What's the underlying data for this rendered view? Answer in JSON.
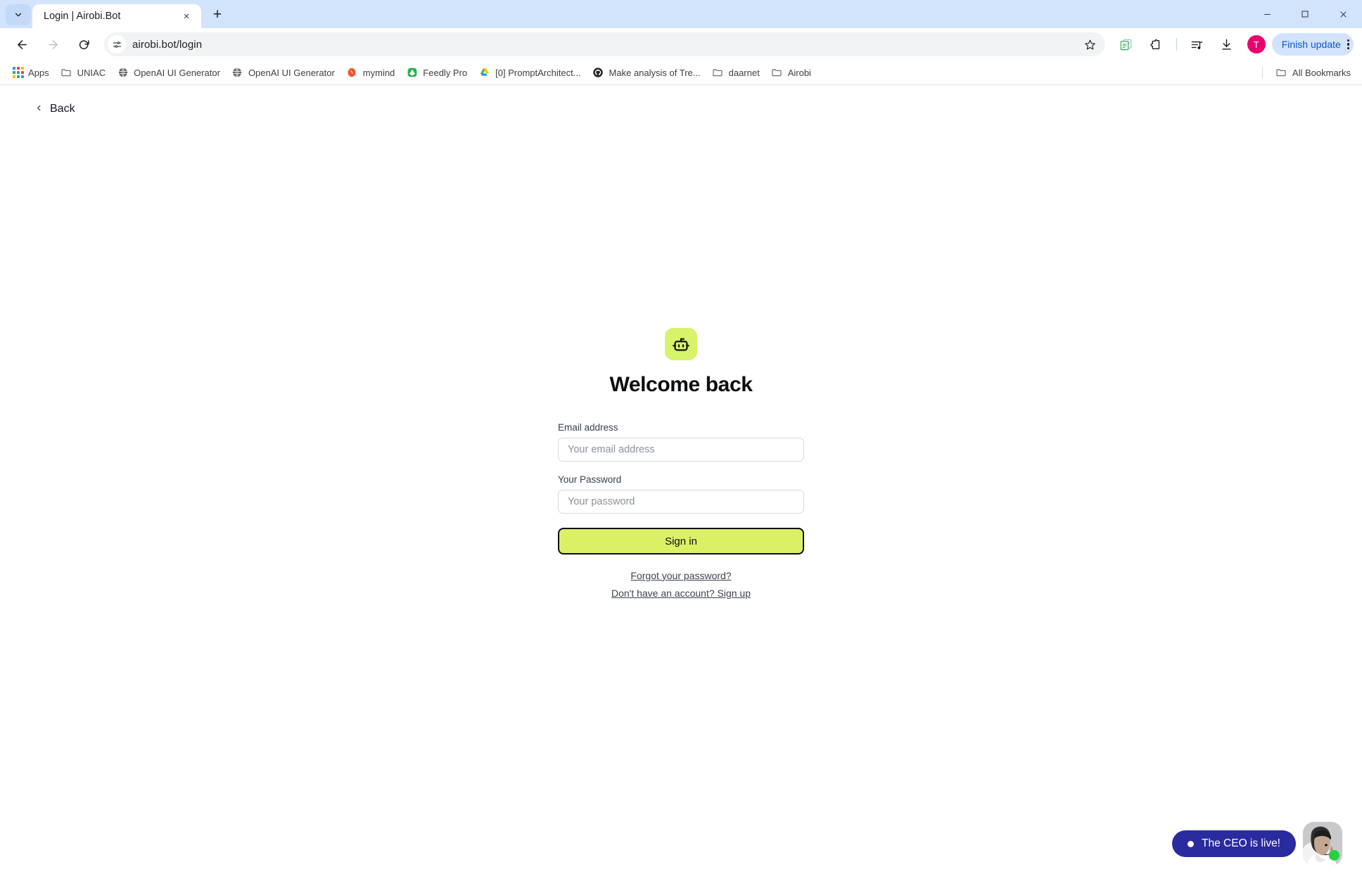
{
  "browser": {
    "tab": {
      "title": "Login | Airobi.Bot",
      "close_label": "×"
    },
    "new_tab_label": "+",
    "tab_search_icon": "chevron-down-icon",
    "window_controls": {
      "minimize": "—",
      "maximize": "□",
      "close": "✕"
    },
    "omnibox": {
      "url": "airobi.bot/login",
      "site_settings_icon": "tune-icon",
      "bookmark_icon": "star-icon"
    },
    "toolbar_icons": [
      "reading-list-icon",
      "extensions-icon",
      "media-controls-icon",
      "downloads-icon"
    ],
    "profile_initial": "T",
    "finish_update_label": "Finish update",
    "menu_icon": "kebab-menu-icon",
    "bookmarks": [
      {
        "label": "Apps",
        "icon": "apps-grid-icon"
      },
      {
        "label": "UNIAC",
        "icon": "folder-icon"
      },
      {
        "label": "OpenAI UI Generator",
        "icon": "globe-icon"
      },
      {
        "label": "OpenAI UI Generator",
        "icon": "globe-icon"
      },
      {
        "label": "mymind",
        "icon": "mymind-icon"
      },
      {
        "label": "Feedly Pro",
        "icon": "feedly-icon"
      },
      {
        "label": "[0] PromptArchitect...",
        "icon": "google-drive-icon"
      },
      {
        "label": "Make analysis of Tre...",
        "icon": "github-icon"
      },
      {
        "label": "daarnet",
        "icon": "folder-icon"
      },
      {
        "label": "Airobi",
        "icon": "folder-icon"
      }
    ],
    "all_bookmarks_label": "All Bookmarks"
  },
  "page": {
    "back_label": "Back",
    "logo_icon": "robot-icon",
    "heading": "Welcome back",
    "form": {
      "email": {
        "label": "Email address",
        "placeholder": "Your email address",
        "value": ""
      },
      "password": {
        "label": "Your Password",
        "placeholder": "Your password",
        "value": ""
      },
      "submit_label": "Sign in"
    },
    "links": {
      "forgot": "Forgot your password?",
      "signup": "Don't have an account? Sign up"
    },
    "ceo_widget": {
      "label": "The CEO is live!",
      "status": "online"
    }
  },
  "colors": {
    "brand_lime": "#dcf066",
    "logo_bg": "#d6f36b",
    "ceo_pill": "#2b2ba0",
    "online_green": "#22d33f",
    "chrome_blue": "#d2e3fc",
    "profile_pink": "#e8006f"
  }
}
